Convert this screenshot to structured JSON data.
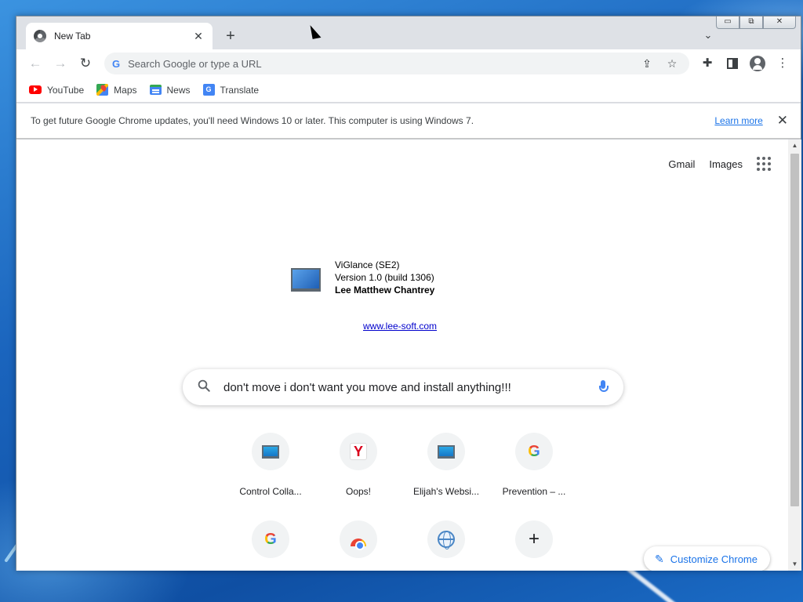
{
  "tab": {
    "title": "New Tab",
    "close": "✕",
    "new_tab": "+",
    "tab_search": "⌄"
  },
  "window_controls": {
    "minimize": "▭",
    "restore": "⧉",
    "close": "✕"
  },
  "toolbar": {
    "back": "←",
    "forward": "→",
    "reload": "↻",
    "omnibox_placeholder": "Search Google or type a URL",
    "omnibox_g": "G",
    "share": "⇪",
    "star": "☆",
    "extensions": "✚",
    "menu": "⋮"
  },
  "bookmarks": [
    {
      "label": "YouTube",
      "icon": "youtube-icon"
    },
    {
      "label": "Maps",
      "icon": "maps-icon"
    },
    {
      "label": "News",
      "icon": "news-icon"
    },
    {
      "label": "Translate",
      "icon": "translate-icon"
    }
  ],
  "infobar": {
    "message": "To get future Google Chrome updates, you'll need Windows 10 or later. This computer is using Windows 7.",
    "learn_more": "Learn more",
    "close": "✕"
  },
  "ntp": {
    "gmail": "Gmail",
    "images": "Images",
    "viglance": {
      "line1": "ViGlance (SE2)",
      "line2": "Version 1.0 (build 1306)",
      "line3": "Lee Matthew Chantrey",
      "link": "www.lee-soft.com"
    },
    "search_value": "don't move i don't want you move and install anything!!!",
    "search_icon": "🔍",
    "shortcuts": [
      {
        "label": "Control Colla...",
        "icon": "pc-icon"
      },
      {
        "label": "Oops!",
        "icon": "yandex-icon"
      },
      {
        "label": "Elijah's Websi...",
        "icon": "pc-icon"
      },
      {
        "label": "Prevention – ...",
        "icon": "google-icon"
      },
      {
        "label": "",
        "icon": "google-icon"
      },
      {
        "label": "",
        "icon": "chrome-icon"
      },
      {
        "label": "",
        "icon": "globe-icon"
      },
      {
        "label": "",
        "icon": "plus-icon"
      }
    ],
    "customize": "Customize Chrome",
    "pencil": "✎"
  },
  "glyphs": {
    "g": "G",
    "y": "Y",
    "plus": "+",
    "tr": "G"
  }
}
